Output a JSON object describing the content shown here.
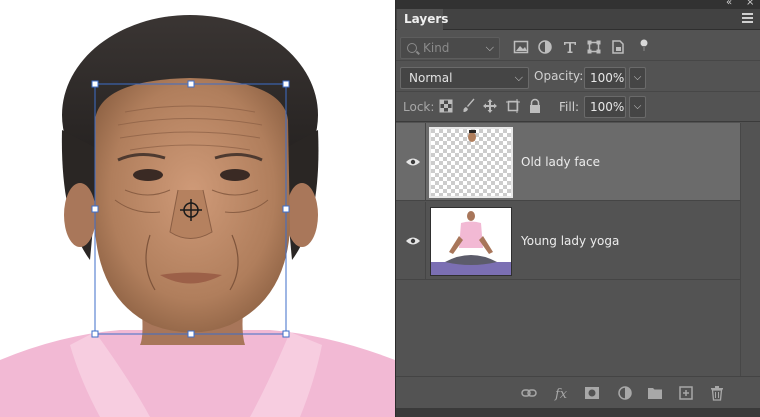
{
  "panel": {
    "tab_label": "Layers",
    "filter": {
      "kind_placeholder": "Kind"
    },
    "blend": {
      "mode": "Normal",
      "opacity_label": "Opacity:",
      "opacity_value": "100%"
    },
    "lock": {
      "label": "Lock:",
      "fill_label": "Fill:",
      "fill_value": "100%"
    },
    "layers": [
      {
        "name": "Old lady face",
        "selected": true,
        "visible": true
      },
      {
        "name": "Young lady yoga",
        "selected": false,
        "visible": true
      }
    ]
  },
  "colors": {
    "panel_bg": "#535353",
    "selected_row": "#6b6b6b",
    "shirt_pink": "#f2b9d4",
    "transform_box": "#3d6ec9"
  },
  "icons": {
    "filter": [
      "pixel-layer-filter-icon",
      "adjustment-filter-icon",
      "type-filter-icon",
      "shape-filter-icon",
      "smart-object-filter-icon",
      "filter-toggle-icon"
    ],
    "lock": [
      "lock-transparent-pixels-icon",
      "lock-image-pixels-icon",
      "lock-position-icon",
      "lock-artboard-icon",
      "lock-all-icon"
    ],
    "footer": [
      "link-layers-icon",
      "fx-icon",
      "add-mask-icon",
      "adjustment-layer-icon",
      "group-folder-icon",
      "new-layer-icon",
      "trash-icon"
    ]
  }
}
